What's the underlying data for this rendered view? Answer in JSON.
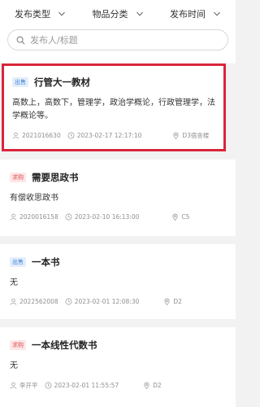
{
  "filters": [
    {
      "label": "发布类型"
    },
    {
      "label": "物品分类"
    },
    {
      "label": "发布时间"
    }
  ],
  "search": {
    "placeholder": "发布人/标题"
  },
  "posts": [
    {
      "tag": "出售",
      "tag_type": "sell",
      "title": "行管大一教材",
      "desc": "高数上，高数下，管理学，政治学概论，行政管理学，法学概论等。",
      "user": "2021016630",
      "time": "2023-02-17 12:17:10",
      "location": "D3宿舍楼"
    },
    {
      "tag": "求购",
      "tag_type": "buy",
      "title": "需要思政书",
      "desc": "有偿收思政书",
      "user": "2020016158",
      "time": "2023-02-10 16:13:00",
      "location": "C5"
    },
    {
      "tag": "出售",
      "tag_type": "sell",
      "title": "一本书",
      "desc": "无",
      "user": "2022562008",
      "time": "2023-02-01 12:08:30",
      "location": "D2"
    },
    {
      "tag": "求购",
      "tag_type": "buy",
      "title": "一本线性代数书",
      "desc": "无",
      "user": "李开平",
      "time": "2023-02-01 11:55:57",
      "location": "D2"
    }
  ],
  "colors": {
    "highlight": "#d9253b",
    "sell_tag": "#3c7fd6",
    "buy_tag": "#e05050"
  }
}
